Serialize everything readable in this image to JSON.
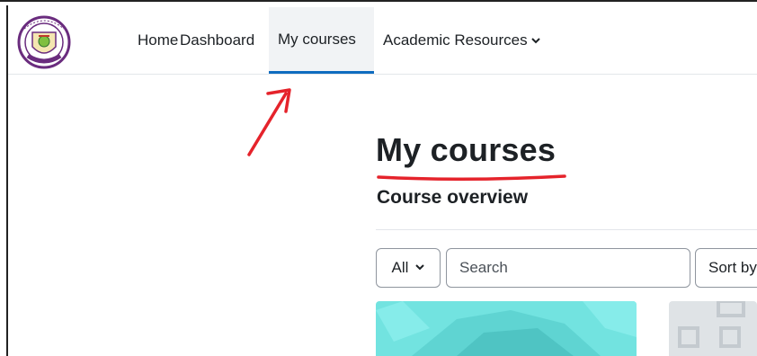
{
  "nav": {
    "logo_alt": "Global College of Engineering and Technology",
    "items": [
      {
        "label": "Home"
      },
      {
        "label": "Dashboard"
      },
      {
        "label": "My courses"
      },
      {
        "label": "Academic Resources"
      }
    ],
    "active": "My courses"
  },
  "main": {
    "page_title": "My courses",
    "section_title": "Course overview",
    "filter": {
      "selected": "All"
    },
    "search": {
      "placeholder": "Search"
    },
    "sort": {
      "label": "Sort by"
    }
  },
  "colors": {
    "accent": "#0f6cbf",
    "annotation": "#e5232b",
    "card1": "#72e3e0",
    "card2": "#dfe3e6"
  }
}
